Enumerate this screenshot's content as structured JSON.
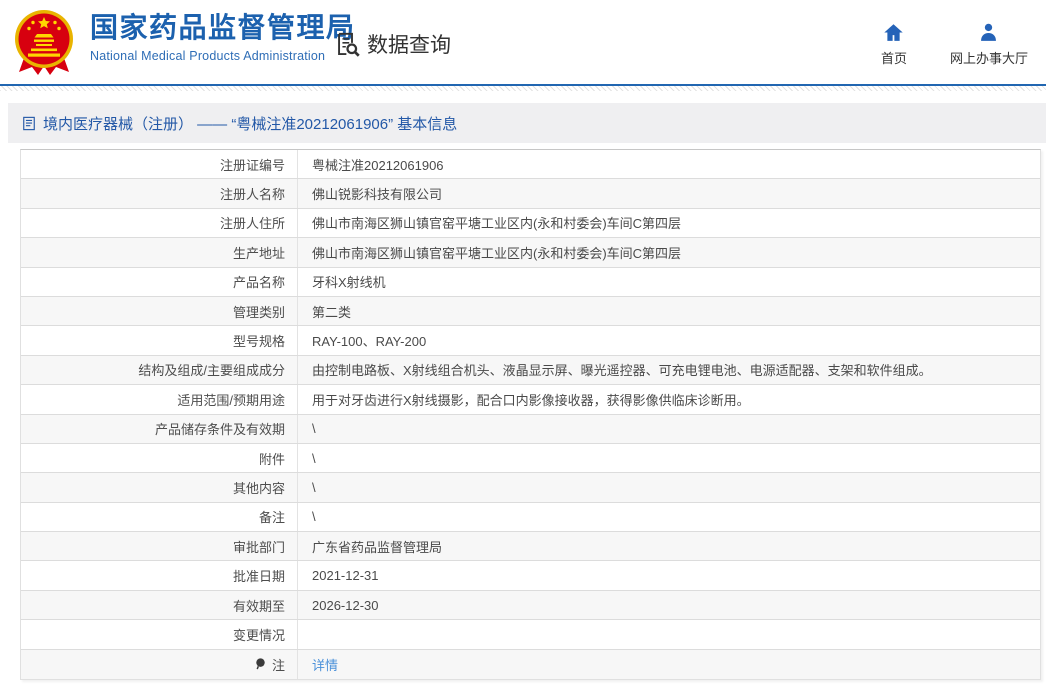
{
  "header": {
    "org_name_cn": "国家药品监督管理局",
    "org_name_en": "National Medical Products Administration",
    "app_title": "数据查询",
    "nav": [
      {
        "label": "首页",
        "icon": "home-icon"
      },
      {
        "label": "网上办事大厅",
        "icon": "user-icon"
      }
    ]
  },
  "breadcrumb": {
    "icon": "document-icon",
    "title": "境内医疗器械（注册） —— “粤械注准20212061906” 基本信息"
  },
  "detail_table": {
    "rows": [
      {
        "label": "注册证编号",
        "value": "粤械注准20212061906"
      },
      {
        "label": "注册人名称",
        "value": "佛山锐影科技有限公司"
      },
      {
        "label": "注册人住所",
        "value": "佛山市南海区狮山镇官窑平塘工业区内(永和村委会)车间C第四层"
      },
      {
        "label": "生产地址",
        "value": "佛山市南海区狮山镇官窑平塘工业区内(永和村委会)车间C第四层"
      },
      {
        "label": "产品名称",
        "value": "牙科X射线机"
      },
      {
        "label": "管理类别",
        "value": "第二类"
      },
      {
        "label": "型号规格",
        "value": "RAY-100、RAY-200"
      },
      {
        "label": "结构及组成/主要组成成分",
        "value": "由控制电路板、X射线组合机头、液晶显示屏、曝光遥控器、可充电锂电池、电源适配器、支架和软件组成。"
      },
      {
        "label": "适用范围/预期用途",
        "value": "用于对牙齿进行X射线摄影，配合口内影像接收器，获得影像供临床诊断用。"
      },
      {
        "label": "产品储存条件及有效期",
        "value": "\\"
      },
      {
        "label": "附件",
        "value": "\\"
      },
      {
        "label": "其他内容",
        "value": "\\"
      },
      {
        "label": "备注",
        "value": "\\"
      },
      {
        "label": "审批部门",
        "value": "广东省药品监督管理局"
      },
      {
        "label": "批准日期",
        "value": "2021-12-31"
      },
      {
        "label": "有效期至",
        "value": "2026-12-30"
      },
      {
        "label": "变更情况",
        "value": ""
      },
      {
        "label": "注",
        "value": "详情",
        "note_icon": true,
        "link": true
      }
    ]
  },
  "colors": {
    "brand_blue": "#1c61ae",
    "nav_icon_blue": "#2563b8",
    "header_rule_blue": "#2166b1",
    "breadcrumb_bg": "#efeff1",
    "breadcrumb_text": "#2358a7",
    "row_alt_bg": "#f7f7f7",
    "link_blue": "#4a90d9",
    "emblem_red": "#d7000f",
    "emblem_gold": "#f2c200"
  }
}
